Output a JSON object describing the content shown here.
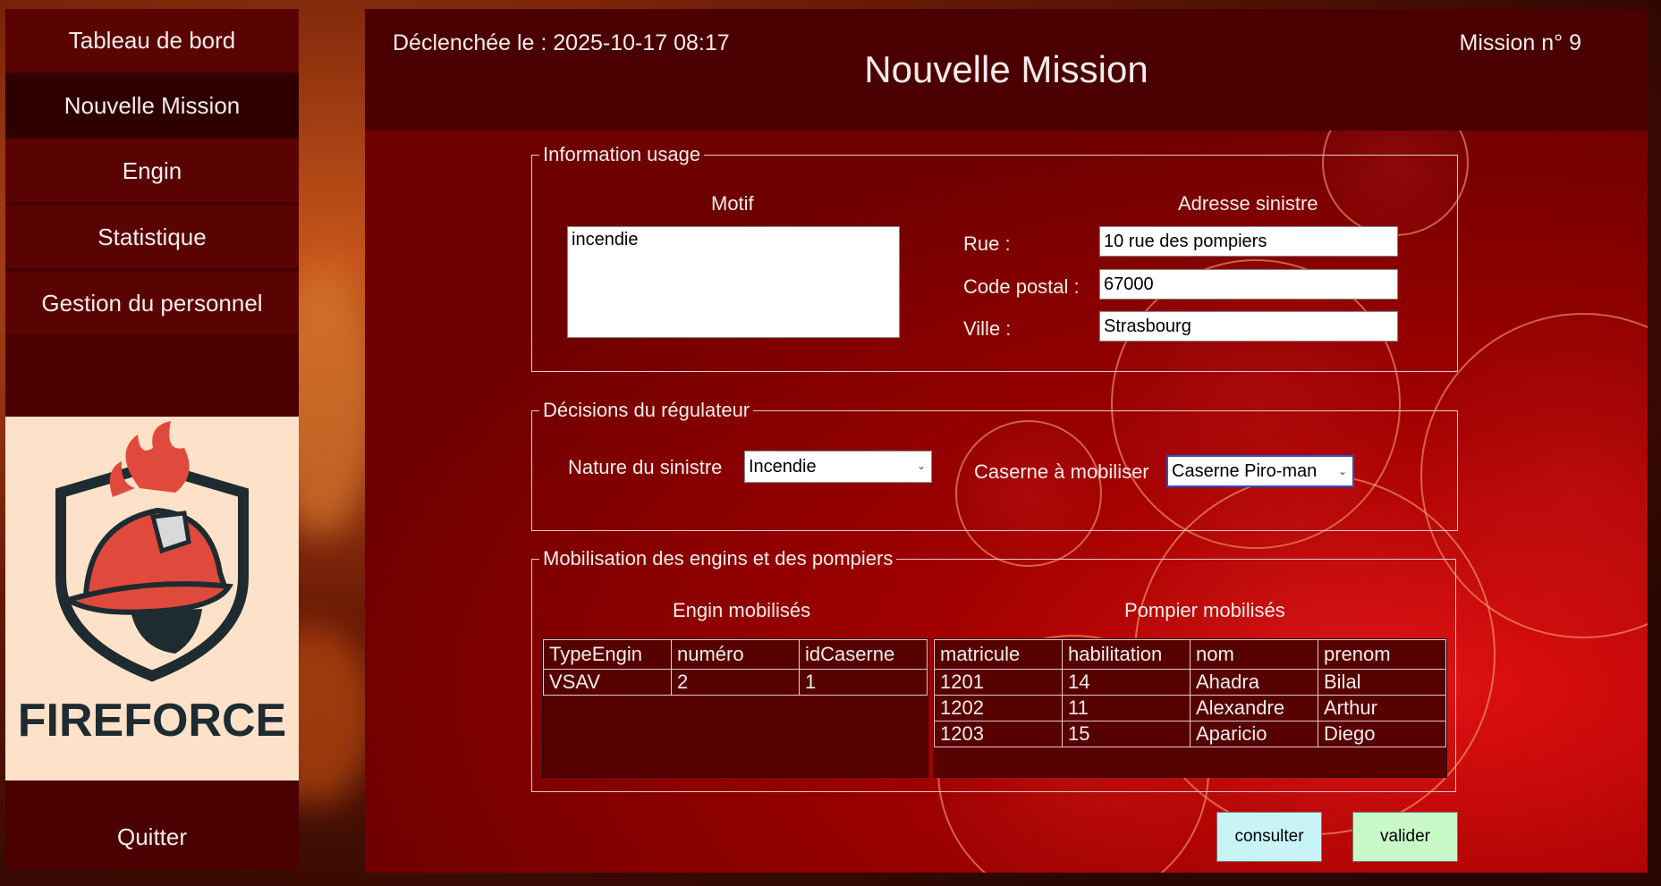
{
  "sidebar": {
    "items": [
      {
        "label": "Tableau de bord"
      },
      {
        "label": "Nouvelle Mission"
      },
      {
        "label": "Engin"
      },
      {
        "label": "Statistique"
      },
      {
        "label": "Gestion du personnel"
      }
    ],
    "active_index": 1,
    "logo_text": "FIREFORCE",
    "quit_label": "Quitter"
  },
  "header": {
    "triggered": "Déclenchée le : 2025-10-17 08:17",
    "title": "Nouvelle Mission",
    "mission_number": "Mission n° 9"
  },
  "info_usage": {
    "legend": "Information usage",
    "motif_label": "Motif",
    "motif_value": "incendie",
    "address_label": "Adresse sinistre",
    "rue_label": "Rue :",
    "rue_value": "10 rue des pompiers",
    "cp_label": "Code postal :",
    "cp_value": "67000",
    "ville_label": "Ville :",
    "ville_value": "Strasbourg"
  },
  "decisions": {
    "legend": "Décisions du régulateur",
    "nature_label": "Nature du sinistre",
    "nature_value": "Incendie",
    "caserne_label": "Caserne à mobiliser",
    "caserne_value": "Caserne Piro-man"
  },
  "mobilisation": {
    "legend": "Mobilisation des engins et des pompiers",
    "engins_title": "Engin mobilisés",
    "engins_columns": [
      "TypeEngin",
      "numéro",
      "idCaserne"
    ],
    "engins_rows": [
      [
        "VSAV",
        "2",
        "1"
      ]
    ],
    "pompiers_title": "Pompier mobilisés",
    "pompiers_columns": [
      "matricule",
      "habilitation",
      "nom",
      "prenom"
    ],
    "pompiers_rows": [
      [
        "1201",
        "14",
        "Ahadra",
        "Bilal"
      ],
      [
        "1202",
        "11",
        "Alexandre",
        "Arthur"
      ],
      [
        "1203",
        "15",
        "Aparicio",
        "Diego"
      ]
    ]
  },
  "actions": {
    "consult_label": "consulter",
    "validate_label": "valider"
  },
  "colors": {
    "sidebar_bg": "#4a0000",
    "header_bg": "#4a0000",
    "consult_bg": "#c8f4f8",
    "validate_bg": "#c8f8c8"
  }
}
